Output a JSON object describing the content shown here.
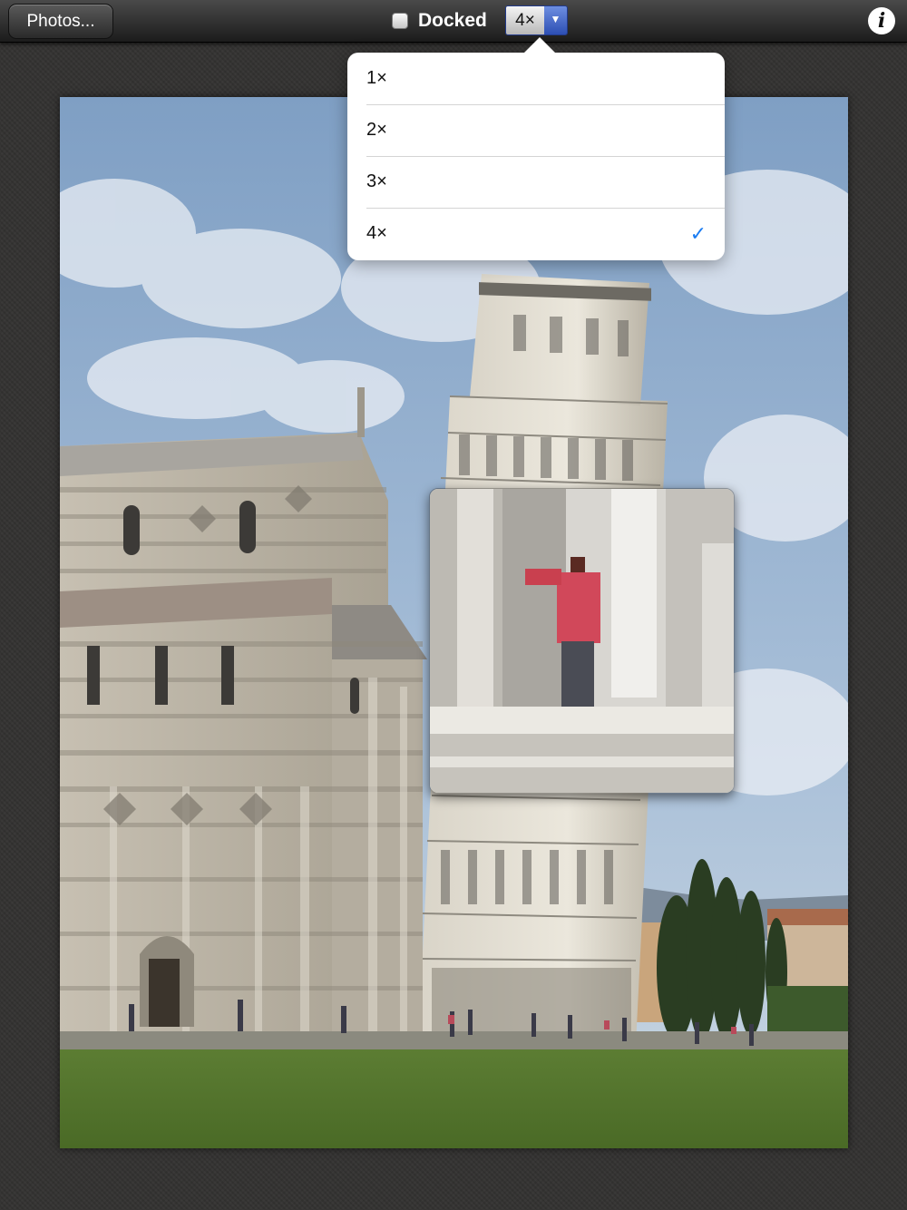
{
  "toolbar": {
    "photos_label": "Photos...",
    "docked_label": "Docked",
    "docked_checked": false,
    "zoom_selected": "4×",
    "info_label": "i"
  },
  "zoom_menu": {
    "options": [
      "1×",
      "2×",
      "3×",
      "4×"
    ],
    "selected_index": 3
  },
  "colors": {
    "accent": "#1a7cf2",
    "toolbar": "#2a2a2a",
    "select_arrow": "#2d4fb4"
  },
  "icons": {
    "info": "info-icon",
    "checkmark": "checkmark-icon",
    "dropdown": "chevron-down-icon"
  }
}
